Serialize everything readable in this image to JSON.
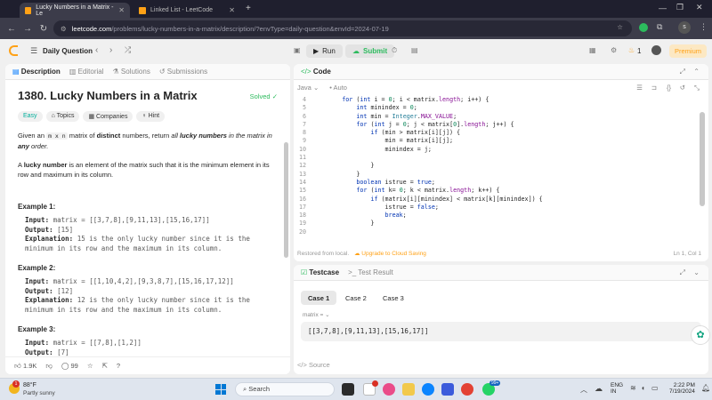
{
  "browser": {
    "tabs": [
      {
        "title": "Lucky Numbers in a Matrix - Le",
        "active": true
      },
      {
        "title": "Linked List - LeetCode",
        "active": false
      }
    ],
    "new_tab": "+",
    "url_host": "leetcode.com",
    "url_rest": "/problems/lucky-numbers-in-a-matrix/description/?envType=daily-question&envId=2024-07-19",
    "profile_letter": "s"
  },
  "header": {
    "daily_question": "Daily Question",
    "run": "Run",
    "submit": "Submit",
    "streak": "1",
    "premium": "Premium"
  },
  "left": {
    "tabs": [
      "Description",
      "Editorial",
      "Solutions",
      "Submissions"
    ],
    "title": "1380. Lucky Numbers in a Matrix",
    "solved": "Solved",
    "chips": [
      "Easy",
      "Topics",
      "Companies",
      "Hint"
    ],
    "desc1_a": "Given an ",
    "desc1_code": "m x n",
    "desc1_b": " matrix of ",
    "desc1_bold1": "distinct",
    "desc1_c": " numbers, return ",
    "desc1_em": "all ",
    "desc1_bold2": "lucky numbers",
    "desc1_d": " in the matrix in ",
    "desc1_bold3": "any",
    "desc1_e": " order.",
    "desc2_a": "A ",
    "desc2_bold": "lucky number",
    "desc2_b": " is an element of the matrix such that it is the minimum element in its row and maximum in its column.",
    "examples": [
      {
        "heading": "Example 1:",
        "input": "matrix = [[3,7,8],[9,11,13],[15,16,17]]",
        "output": "[15]",
        "explanation": "15 is the only lucky number since it is the minimum in its row and the maximum in its column."
      },
      {
        "heading": "Example 2:",
        "input": "matrix = [[1,10,4,2],[9,3,8,7],[15,16,17,12]]",
        "output": "[12]",
        "explanation": "12 is the only lucky number since it is the minimum in its row and the maximum in its column."
      },
      {
        "heading": "Example 3:",
        "input": "matrix = [[7,8],[1,2]]",
        "output": "[7]",
        "explanation": ""
      }
    ],
    "labels": {
      "input": "Input:",
      "output": "Output:",
      "explanation": "Explanation:"
    },
    "likes": "1.9K",
    "comments": "99"
  },
  "code": {
    "panel_title": "Code",
    "language": "Java",
    "auto": "Auto",
    "lines": [
      {
        "n": "4",
        "text": "        for (int i = 0; i < matrix.length; i++) {"
      },
      {
        "n": "5",
        "text": "            int minindex = 0;"
      },
      {
        "n": "6",
        "text": "            int min = Integer.MAX_VALUE;"
      },
      {
        "n": "7",
        "text": "            for (int j = 0; j < matrix[0].length; j++) {"
      },
      {
        "n": "8",
        "text": "                if (min > matrix[i][j]) {"
      },
      {
        "n": "9",
        "text": "                    min = matrix[i][j];"
      },
      {
        "n": "10",
        "text": "                    minindex = j;"
      },
      {
        "n": "11",
        "text": ""
      },
      {
        "n": "12",
        "text": "                }"
      },
      {
        "n": "13",
        "text": "            }"
      },
      {
        "n": "14",
        "text": "            boolean istrue = true;"
      },
      {
        "n": "15",
        "text": "            for (int k= 0; k < matrix.length; k++) {"
      },
      {
        "n": "16",
        "text": "                if (matrix[i][minindex] < matrix[k][minindex]) {"
      },
      {
        "n": "17",
        "text": "                    istrue = false;"
      },
      {
        "n": "18",
        "text": "                    break;"
      },
      {
        "n": "19",
        "text": "                }"
      },
      {
        "n": "20",
        "text": ""
      }
    ],
    "restored": "Restored from local.",
    "upgrade": "Upgrade to Cloud Saving",
    "position": "Ln 1, Col 1"
  },
  "testcase": {
    "tab_active": "Testcase",
    "tab_result": "Test Result",
    "cases": [
      "Case 1",
      "Case 2",
      "Case 3"
    ],
    "var_label": "matrix =",
    "value": "[[3,7,8],[9,11,13],[15,16,17]]",
    "source": "Source"
  },
  "taskbar": {
    "weather_temp": "88°F",
    "weather_desc": "Partly sunny",
    "search": "Search",
    "lang1": "ENG",
    "lang2": "IN",
    "time": "2:22 PM",
    "date": "7/19/2024",
    "badge": "99+"
  },
  "colors": {
    "accent": "#ffa116",
    "green": "#2cbb5d",
    "easy": "#00af9b"
  }
}
